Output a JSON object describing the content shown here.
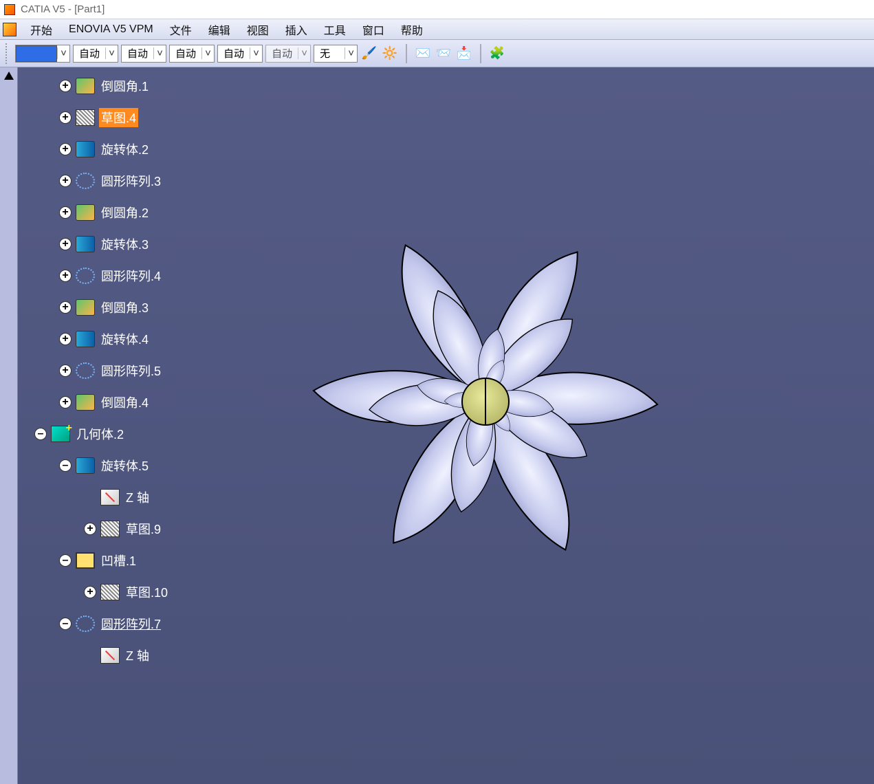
{
  "titlebar": {
    "title": "CATIA V5 - [Part1]"
  },
  "menubar": {
    "items": [
      "开始",
      "ENOVIA V5 VPM",
      "文件",
      "编辑",
      "视图",
      "插入",
      "工具",
      "窗口",
      "帮助"
    ]
  },
  "toolbar": {
    "combos": [
      "自动",
      "自动",
      "自动",
      "自动",
      "自动",
      "无"
    ]
  },
  "tree": {
    "nodes": [
      {
        "indent": 1,
        "exp": "+",
        "icon": "fillet",
        "label": "倒圆角.1"
      },
      {
        "indent": 1,
        "exp": "+",
        "icon": "sketch",
        "label": "草图.4",
        "selected": true
      },
      {
        "indent": 1,
        "exp": "+",
        "icon": "revolve",
        "label": "旋转体.2"
      },
      {
        "indent": 1,
        "exp": "+",
        "icon": "pattern",
        "label": "圆形阵列.3"
      },
      {
        "indent": 1,
        "exp": "+",
        "icon": "fillet",
        "label": "倒圆角.2"
      },
      {
        "indent": 1,
        "exp": "+",
        "icon": "revolve",
        "label": "旋转体.3"
      },
      {
        "indent": 1,
        "exp": "+",
        "icon": "pattern",
        "label": "圆形阵列.4"
      },
      {
        "indent": 1,
        "exp": "+",
        "icon": "fillet",
        "label": "倒圆角.3"
      },
      {
        "indent": 1,
        "exp": "+",
        "icon": "revolve",
        "label": "旋转体.4"
      },
      {
        "indent": 1,
        "exp": "+",
        "icon": "pattern",
        "label": "圆形阵列.5"
      },
      {
        "indent": 1,
        "exp": "+",
        "icon": "fillet",
        "label": "倒圆角.4"
      },
      {
        "indent": 0,
        "exp": "–",
        "icon": "body",
        "label": "几何体.2"
      },
      {
        "indent": 1,
        "exp": "–",
        "icon": "revolve",
        "label": "旋转体.5"
      },
      {
        "indent": 2,
        "exp": "",
        "icon": "axis",
        "label": "Z 轴"
      },
      {
        "indent": 2,
        "exp": "+",
        "icon": "sketch",
        "label": "草图.9"
      },
      {
        "indent": 1,
        "exp": "–",
        "icon": "pocket",
        "label": "凹槽.1"
      },
      {
        "indent": 2,
        "exp": "+",
        "icon": "sketch",
        "label": "草图.10"
      },
      {
        "indent": 1,
        "exp": "–",
        "icon": "pattern",
        "label": "圆形阵列.7",
        "under": true
      },
      {
        "indent": 2,
        "exp": "",
        "icon": "axis",
        "label": "Z 轴"
      }
    ]
  }
}
